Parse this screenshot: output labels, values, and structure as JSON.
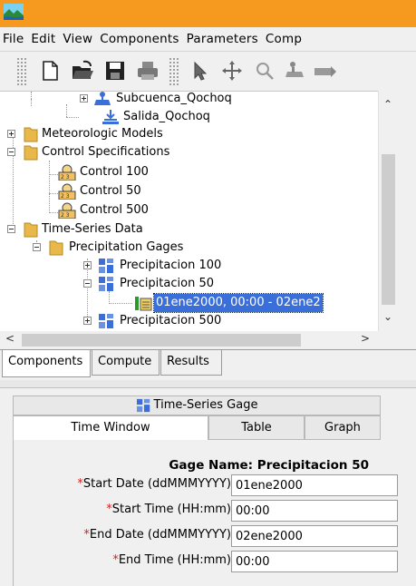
{
  "menu": [
    "File",
    "Edit",
    "View",
    "Components",
    "Parameters",
    "Comp"
  ],
  "toolbar_icons": [
    "new-file-icon",
    "open-folder-icon",
    "save-icon",
    "print-icon",
    "select-arrow-icon",
    "pan-icon",
    "zoom-icon",
    "add-subbasin-icon",
    "add-reach-icon"
  ],
  "tree": {
    "subcuenca": "Subcuenca_Qochoq",
    "salida": "Salida_Qochoq",
    "meteorologic": "Meteorologic Models",
    "control_specs": "Control Specifications",
    "control_100": "Control 100",
    "control_50": "Control 50",
    "control_500": "Control 500",
    "time_series": "Time-Series Data",
    "precip_gages": "Precipitation Gages",
    "precip_100": "Precipitacion 100",
    "precip_50": "Precipitacion 50",
    "window_50": "01ene2000, 00:00 - 02ene2",
    "precip_500": "Precipitacion 500"
  },
  "bottom_tabs": [
    "Components",
    "Compute",
    "Results"
  ],
  "editor": {
    "header": "Time-Series Gage",
    "tabs": [
      "Time Window",
      "Table",
      "Graph"
    ],
    "gage_name_label": "Gage Name:",
    "gage_name_value": "Precipitacion 50",
    "fields": [
      {
        "label": "Start Date (ddMMMYYYY)",
        "value": "01ene2000"
      },
      {
        "label": "Start Time (HH:mm)",
        "value": "00:00"
      },
      {
        "label": "End Date (ddMMMYYYY)",
        "value": "02ene2000"
      },
      {
        "label": "End Time (HH:mm)",
        "value": "00:00"
      }
    ],
    "required_marker": "*"
  },
  "colors": {
    "titlebar": "#f59a1e",
    "selection": "#3a6ed8",
    "required": "#d62020",
    "folder": "#e8b84a"
  }
}
